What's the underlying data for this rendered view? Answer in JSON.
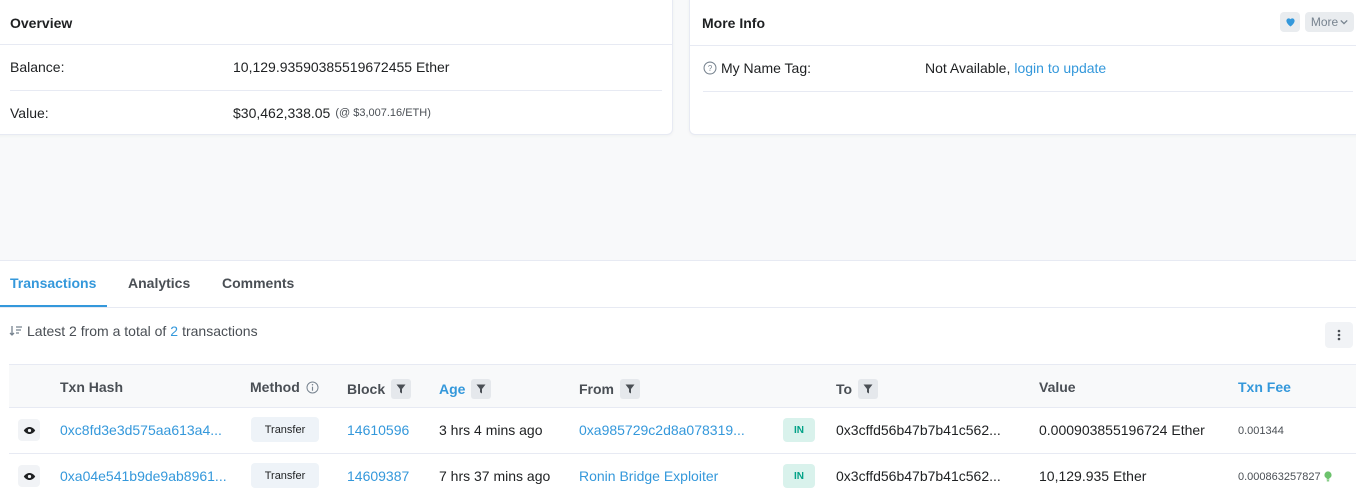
{
  "overview": {
    "title": "Overview",
    "balance_label": "Balance:",
    "balance_value": "10,129.93590385519672455 Ether",
    "value_label": "Value:",
    "value_amount": "$30,462,338.05",
    "value_rate": "(@ $3,007.16/ETH)"
  },
  "more_info": {
    "title": "More Info",
    "more_label": "More",
    "name_tag_label": "My Name Tag:",
    "name_tag_value": "Not Available,",
    "login_link": "login to update"
  },
  "tabs": [
    {
      "label": "Transactions",
      "active": true
    },
    {
      "label": "Analytics",
      "active": false
    },
    {
      "label": "Comments",
      "active": false
    }
  ],
  "summary": {
    "prefix": "Latest 2 from a total of",
    "count": "2",
    "suffix": "transactions"
  },
  "table": {
    "headers": {
      "txn_hash": "Txn Hash",
      "method": "Method",
      "block": "Block",
      "age": "Age",
      "from": "From",
      "to": "To",
      "value": "Value",
      "txn_fee": "Txn Fee"
    },
    "rows": [
      {
        "txn_hash": "0xc8fd3e3d575aa613a4...",
        "method": "Transfer",
        "block": "14610596",
        "age": "3 hrs 4 mins ago",
        "from": "0xa985729c2d8a078319...",
        "direction": "IN",
        "to": "0x3cffd56b47b7b41c562...",
        "value": "0.000903855196724 Ether",
        "fee": "0.001344"
      },
      {
        "txn_hash": "0xa04e541b9de9ab8961...",
        "method": "Transfer",
        "block": "14609387",
        "age": "7 hrs 37 mins ago",
        "from": "Ronin Bridge Exploiter",
        "direction": "IN",
        "to": "0x3cffd56b47b7b41c562...",
        "value": "10,129.935 Ether",
        "fee": "0.000863257827"
      }
    ]
  },
  "colors": {
    "accent": "#3498db",
    "in_badge": "#00a186",
    "border": "#e7eaf3"
  }
}
